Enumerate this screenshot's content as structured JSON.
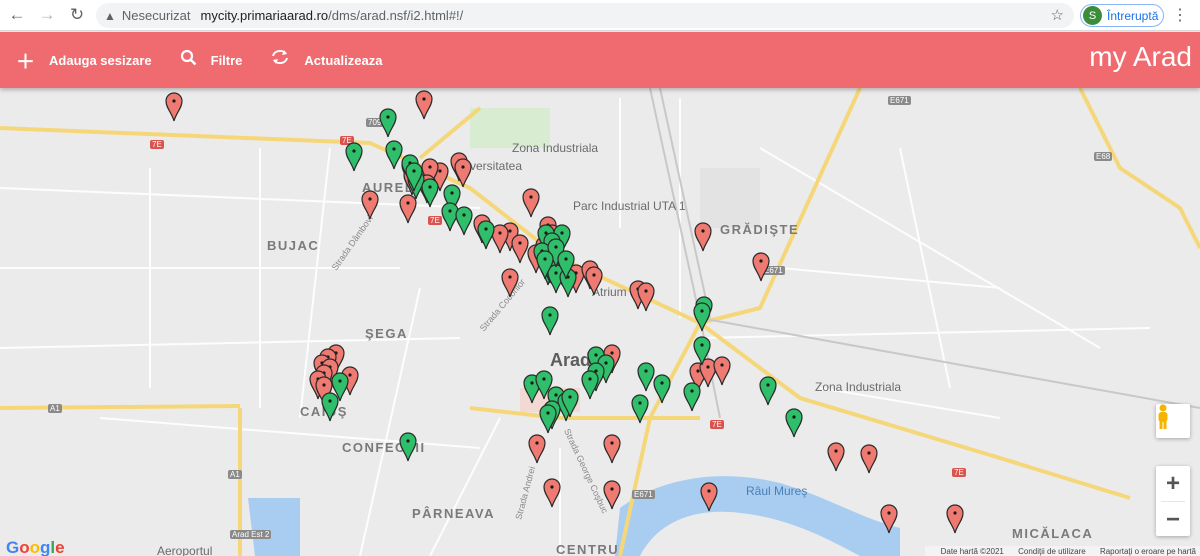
{
  "browser": {
    "security_label": "Nesecurizat",
    "url_host": "mycity.primariaarad.ro",
    "url_path": "/dms/arad.nsf/i2.html#!/",
    "profile_initial": "S",
    "profile_status": "Întreruptă"
  },
  "header": {
    "add_label": "Adauga sesizare",
    "filter_label": "Filtre",
    "refresh_label": "Actualizeaza",
    "brand": "my Arad",
    "color": "#ef6b70"
  },
  "map": {
    "districts": {
      "bujac": "BUJAC",
      "sega": "ŞEGA",
      "aurel_vlaicu": "AUREL VL",
      "gradiste": "GRĂDIŞTE",
      "confectii": "CONFECŢII",
      "caius": "CAIUŞ",
      "parneava": "PÂRNEAVA",
      "micalaca": "MICĂLACA",
      "centru": "CENTRU"
    },
    "city": "Arad",
    "pois": {
      "zona_ind_1": "Zona Industriala",
      "zona_ind_2": "Zona Industriala",
      "parc_uta": "Parc Industrial UTA 1",
      "univ": "Universitatea",
      "atrium": "Atrium M",
      "aeroport": "Aeroportul",
      "raul": "Râul Mureş"
    },
    "streets": {
      "s1": "Strada Dâmbovi",
      "s2": "Strada Cocorilor",
      "s3": "Strada George Coşbuc",
      "s4": "Strada Andrei"
    },
    "roads": {
      "e671_top": "E671",
      "e68": "E68",
      "e671_mid": "E671",
      "e671_bot": "E671",
      "r709": "709",
      "r7e_a": "7E",
      "r7e_b": "7E",
      "r7e_c": "7E",
      "r7e_d": "7E",
      "r7e_e": "7E",
      "a1_a": "A1",
      "a1_b": "A1",
      "arad_est": "Arad Est 2"
    },
    "pin_colors": {
      "red": "#ef7a72",
      "green": "#2fbf6b"
    },
    "pin_counts": {
      "red": 54,
      "green": 46
    },
    "google": "Google",
    "attribution": {
      "data": "Date hartă ©2021",
      "terms": "Condiţii de utilizare",
      "report": "Raportaţi o eroare pe hartă"
    },
    "zoom_in": "+",
    "zoom_out": "−"
  }
}
